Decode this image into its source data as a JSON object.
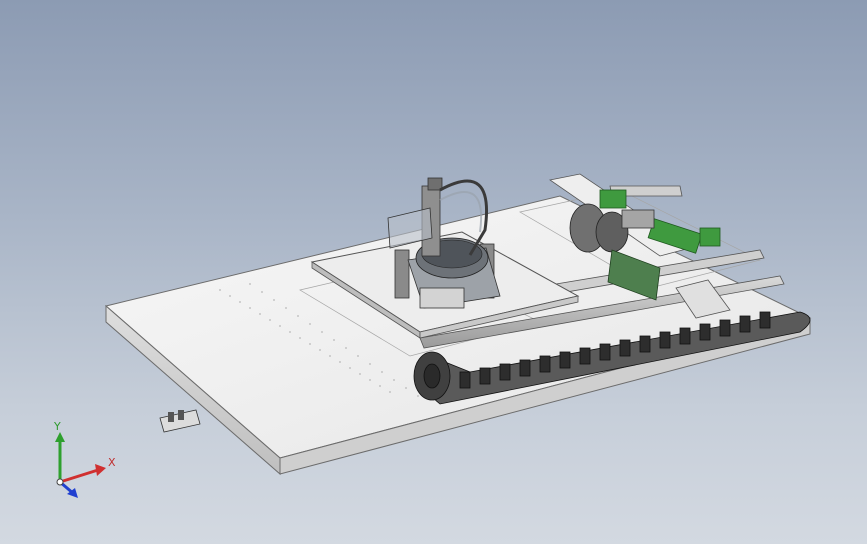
{
  "viewport": {
    "background_top": "#8c9bb3",
    "background_bottom": "#d3d9e1"
  },
  "triad": {
    "x_label": "X",
    "y_label": "Y",
    "x_color": "#d03030",
    "y_color": "#2ea02e",
    "z_color": "#2040d0"
  },
  "model": {
    "plate_color": "#f1f1f1",
    "edge_color": "#6c6c6c",
    "accent_green": "#3f9a3f"
  }
}
